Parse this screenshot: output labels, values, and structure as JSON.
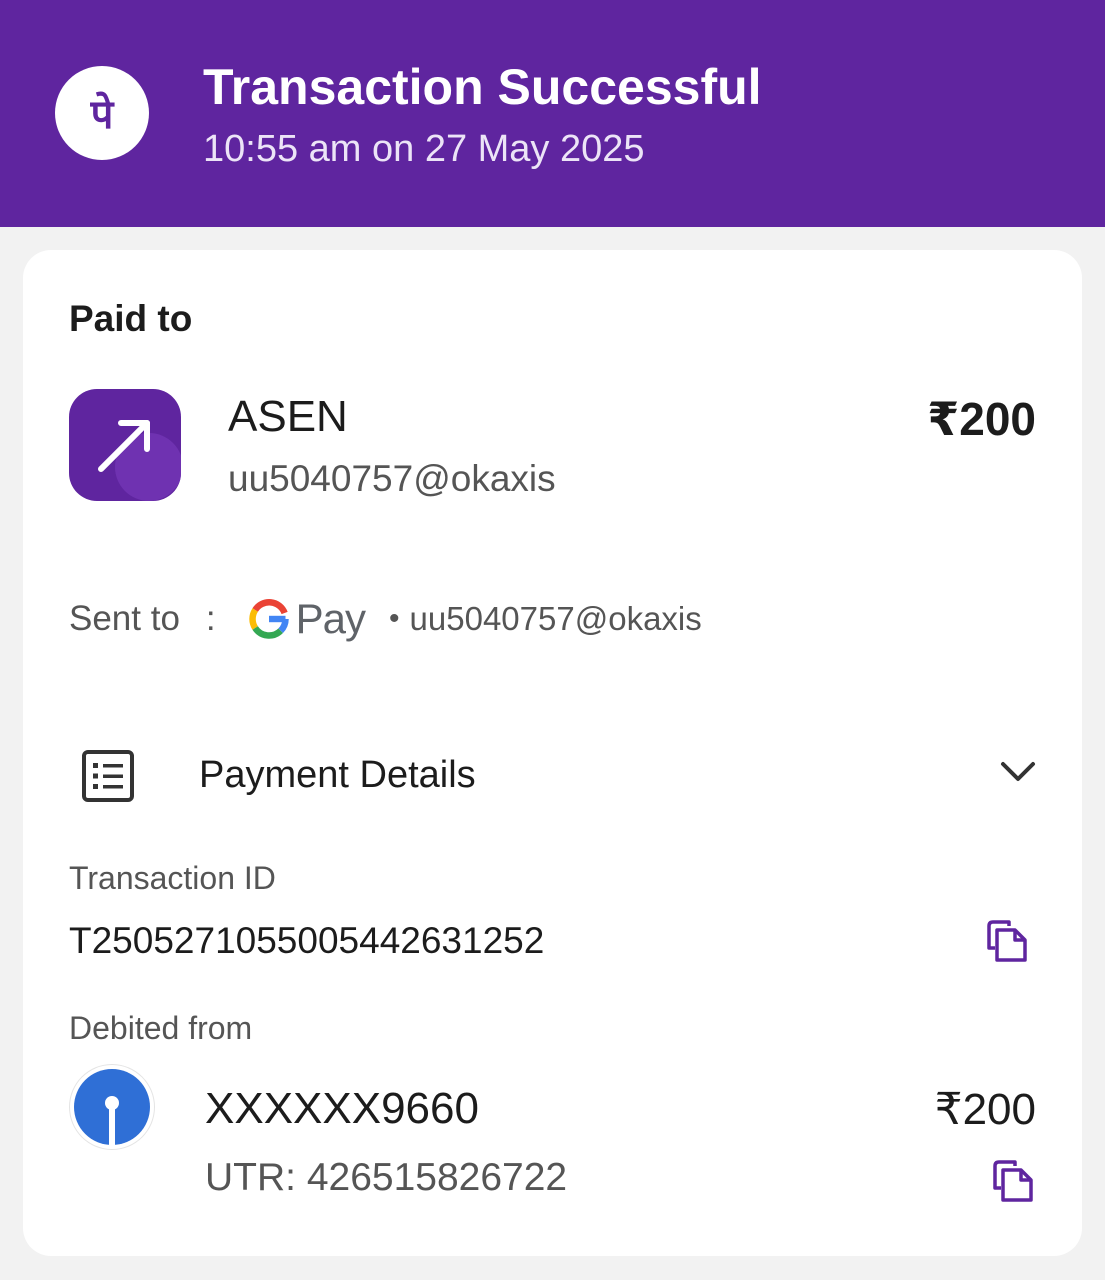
{
  "header": {
    "title": "Transaction Successful",
    "subtitle": "10:55 am on 27 May 2025",
    "logo_glyph": "पे",
    "background_color": "#5f259f"
  },
  "paid_to": {
    "label": "Paid to",
    "name": "ASEN",
    "upi_id": "uu5040757@okaxis",
    "amount": "₹200",
    "avatar_icon": "arrow-up-right-icon"
  },
  "sent_to": {
    "label": "Sent to",
    "separator": ":",
    "app_name": "Pay",
    "bullet": "•",
    "upi_id": "uu5040757@okaxis"
  },
  "payment_details": {
    "label": "Payment Details",
    "expand_icon": "chevron-down-icon"
  },
  "transaction": {
    "id_label": "Transaction ID",
    "id_value": "T2505271055005442631252"
  },
  "debited": {
    "label": "Debited from",
    "account": "XXXXXX9660",
    "amount": "₹200",
    "utr": "UTR: 426515826722"
  },
  "colors": {
    "accent": "#5f259f",
    "bank_blue": "#2f6fd6"
  }
}
